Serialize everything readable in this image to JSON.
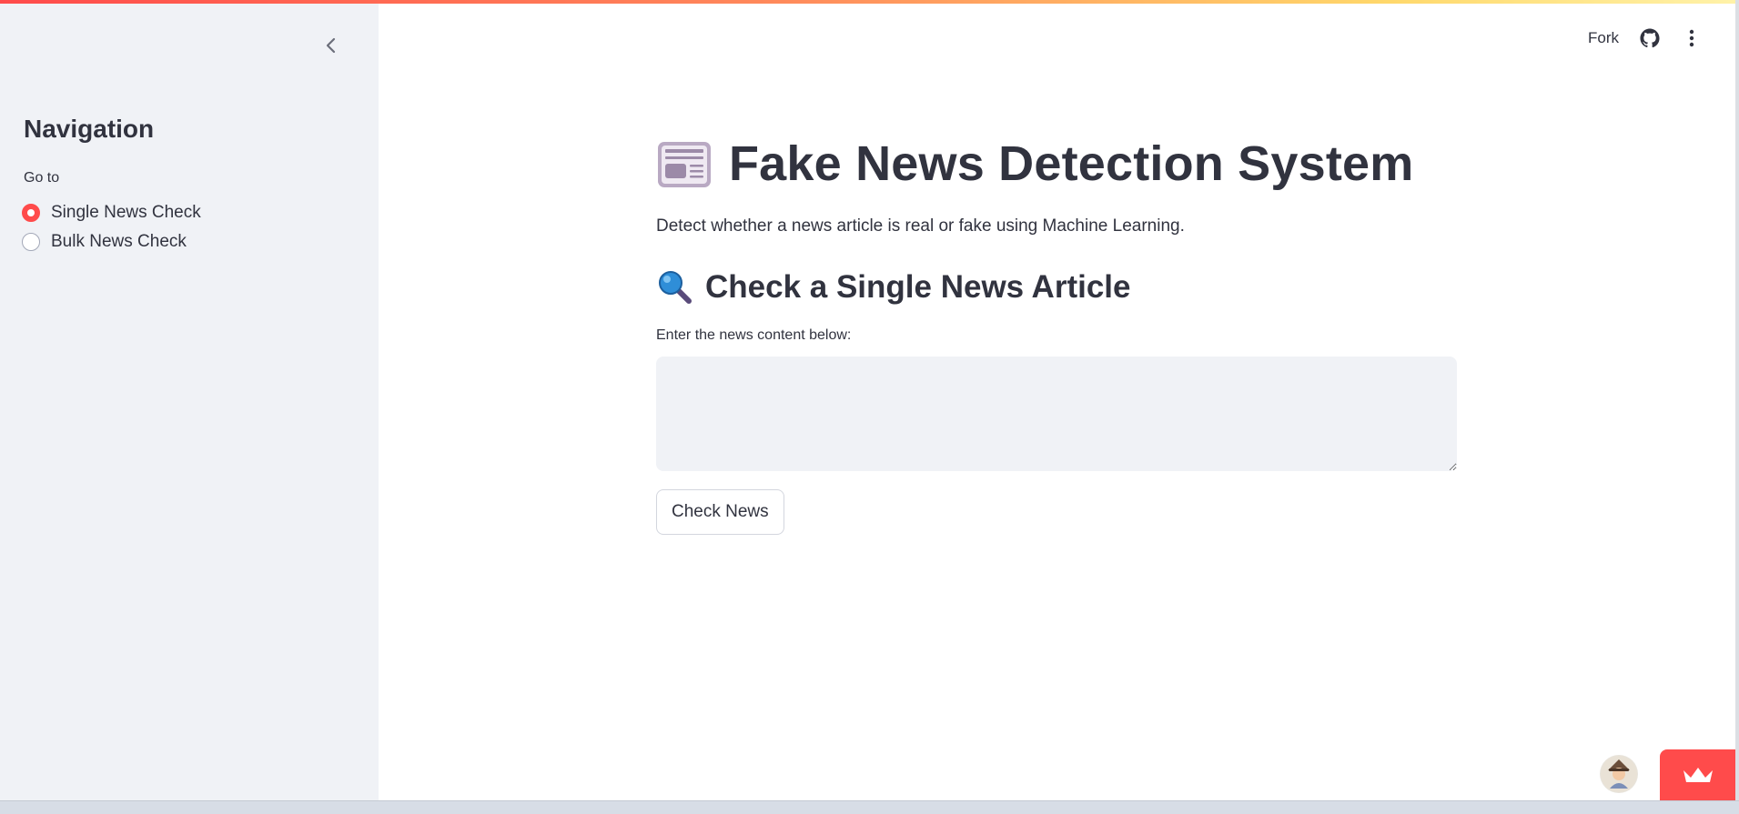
{
  "sidebar": {
    "title": "Navigation",
    "radio_label": "Go to",
    "options": [
      {
        "label": "Single News Check",
        "selected": true
      },
      {
        "label": "Bulk News Check",
        "selected": false
      }
    ]
  },
  "toolbar": {
    "fork_label": "Fork"
  },
  "main": {
    "title": "Fake News Detection System",
    "title_icon": "newspaper-icon",
    "subtitle": "Detect whether a news article is real or fake using Machine Learning.",
    "section_title": "Check a Single News Article",
    "section_icon": "magnifier-icon",
    "input_label": "Enter the news content below:",
    "input_value": "",
    "button_label": "Check News"
  },
  "colors": {
    "accent": "#ff4b4b",
    "sidebar_bg": "#f0f2f6",
    "text": "#31333f"
  }
}
